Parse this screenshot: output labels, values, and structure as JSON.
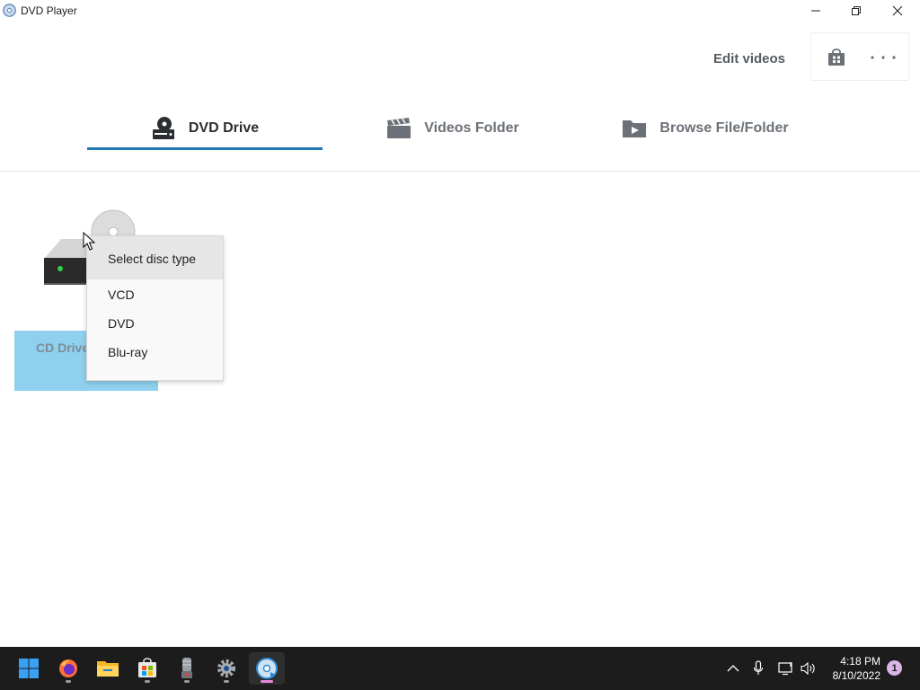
{
  "window": {
    "title": "DVD Player"
  },
  "header": {
    "edit_videos_label": "Edit videos"
  },
  "tabs": [
    {
      "label": "DVD Drive",
      "icon": "dvd-drive-icon",
      "active": true
    },
    {
      "label": "Videos Folder",
      "icon": "clapperboard-icon",
      "active": false
    },
    {
      "label": "Browse File/Folder",
      "icon": "folder-play-icon",
      "active": false
    }
  ],
  "drive": {
    "label": "CD Drive"
  },
  "context_menu": {
    "header": "Select disc type",
    "items": [
      "VCD",
      "DVD",
      "Blu-ray"
    ]
  },
  "taskbar": {
    "time": "4:18 PM",
    "date": "8/10/2022",
    "notification_count": "1"
  },
  "colors": {
    "accent": "#1f77b4",
    "tile_highlight": "#8fd0ee",
    "taskbar": "#1c1c1c"
  }
}
